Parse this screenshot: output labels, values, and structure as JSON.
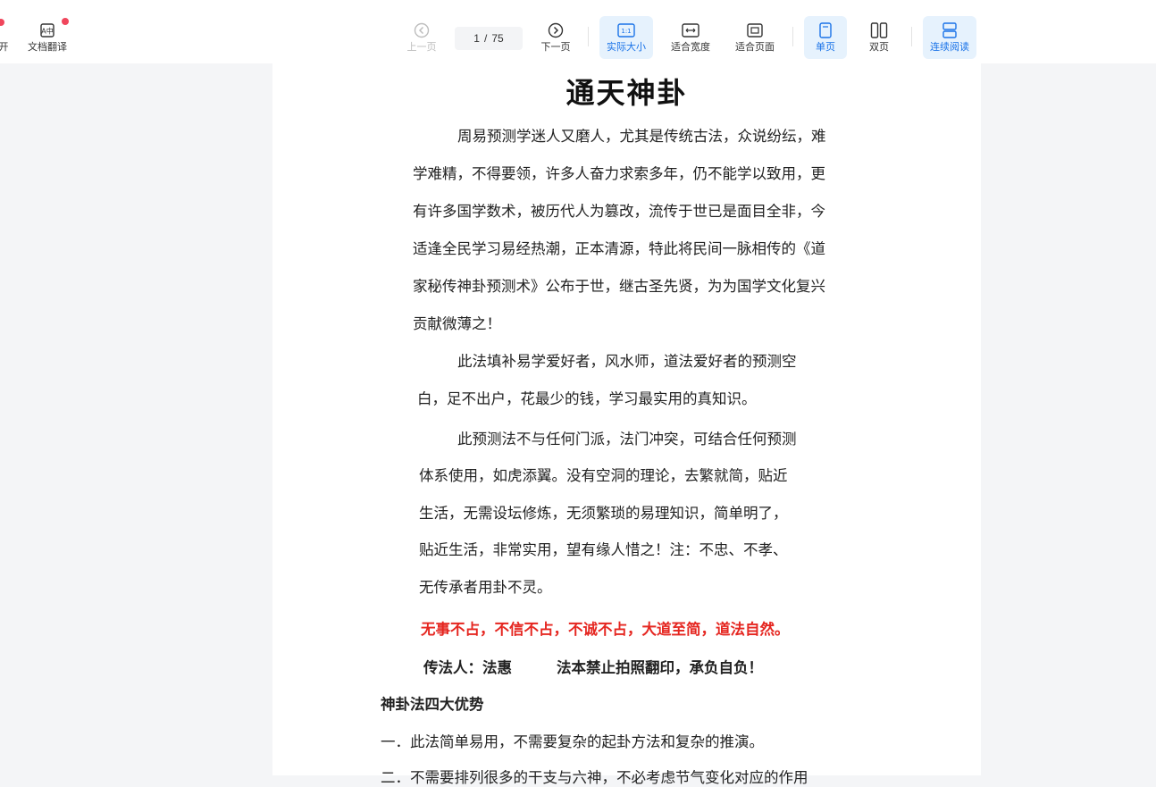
{
  "toolbar": {
    "left_cut_label": "开",
    "translate_label": "文档翻译",
    "prev_label": "上一页",
    "page_current": "1",
    "page_separator": "/",
    "page_total": "75",
    "next_label": "下一页",
    "actual_size_label": "实际大小",
    "fit_width_label": "适合宽度",
    "fit_page_label": "适合页面",
    "single_page_label": "单页",
    "double_page_label": "双页",
    "continuous_label": "连续阅读"
  },
  "document": {
    "title": "通天神卦",
    "p1": [
      "周易预测学迷人又磨人，尤其是传统古法，众说纷纭，难",
      "学难精，不得要领，许多人奋力求索多年，仍不能学以致用，更",
      "有许多国学数术，被历代人为篡改，流传于世已是面目全非，今",
      "适逢全民学习易经热潮，正本清源，特此将民间一脉相传的《道",
      "家秘传神卦预测术》公布于世，继古圣先贤，为为国学文化复兴",
      "贡献微薄之！"
    ],
    "p2": [
      "此法填补易学爱好者，风水师，道法爱好者的预测空",
      "白，足不出户，花最少的钱，学习最实用的真知识。"
    ],
    "p3": [
      "此预测法不与任何门派，法门冲突，可结合任何预测",
      "体系使用，如虎添翼。没有空洞的理论，去繁就简，贴近",
      "生活，无需设坛修炼，无须繁琐的易理知识，简单明了，",
      "贴近生活，非常实用，望有缘人惜之！注：不忠、不孝、",
      "无传承者用卦不灵。"
    ],
    "motto": "无事不占，不信不占，不诚不占，大道至简，道法自然。",
    "transmitter": "传法人：法惠",
    "copyright": "法本禁止拍照翻印，承负自负！",
    "section_heading": "神卦法四大优势",
    "item1": "一．此法简单易用，不需要复杂的起卦方法和复杂的推演。",
    "item2_partial": "二．不需要排列很多的干支与六神，不必考虑节气变化对应的作用"
  }
}
